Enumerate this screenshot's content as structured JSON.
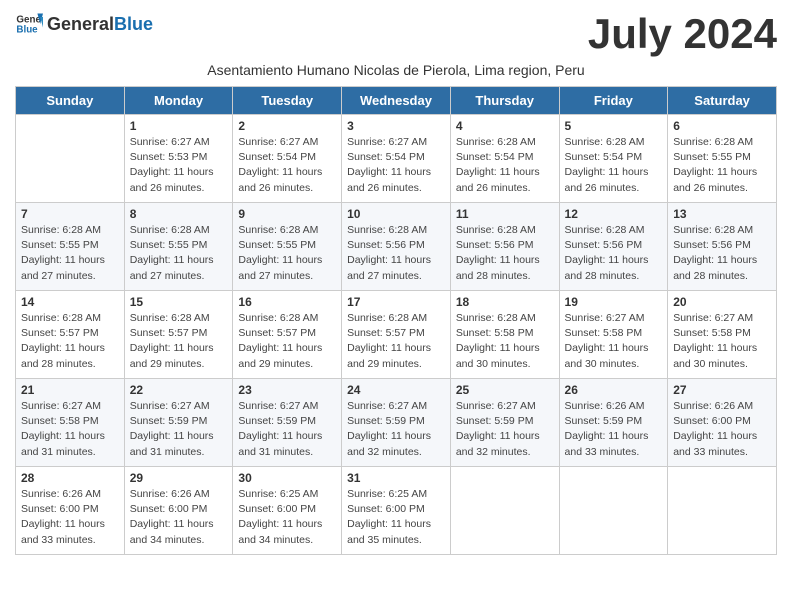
{
  "logo": {
    "general": "General",
    "blue": "Blue"
  },
  "title": "July 2024",
  "subtitle": "Asentamiento Humano Nicolas de Pierola, Lima region, Peru",
  "days_of_week": [
    "Sunday",
    "Monday",
    "Tuesday",
    "Wednesday",
    "Thursday",
    "Friday",
    "Saturday"
  ],
  "weeks": [
    [
      {
        "day": "",
        "info": ""
      },
      {
        "day": "1",
        "info": "Sunrise: 6:27 AM\nSunset: 5:53 PM\nDaylight: 11 hours\nand 26 minutes."
      },
      {
        "day": "2",
        "info": "Sunrise: 6:27 AM\nSunset: 5:54 PM\nDaylight: 11 hours\nand 26 minutes."
      },
      {
        "day": "3",
        "info": "Sunrise: 6:27 AM\nSunset: 5:54 PM\nDaylight: 11 hours\nand 26 minutes."
      },
      {
        "day": "4",
        "info": "Sunrise: 6:28 AM\nSunset: 5:54 PM\nDaylight: 11 hours\nand 26 minutes."
      },
      {
        "day": "5",
        "info": "Sunrise: 6:28 AM\nSunset: 5:54 PM\nDaylight: 11 hours\nand 26 minutes."
      },
      {
        "day": "6",
        "info": "Sunrise: 6:28 AM\nSunset: 5:55 PM\nDaylight: 11 hours\nand 26 minutes."
      }
    ],
    [
      {
        "day": "7",
        "info": "Sunrise: 6:28 AM\nSunset: 5:55 PM\nDaylight: 11 hours\nand 27 minutes."
      },
      {
        "day": "8",
        "info": "Sunrise: 6:28 AM\nSunset: 5:55 PM\nDaylight: 11 hours\nand 27 minutes."
      },
      {
        "day": "9",
        "info": "Sunrise: 6:28 AM\nSunset: 5:55 PM\nDaylight: 11 hours\nand 27 minutes."
      },
      {
        "day": "10",
        "info": "Sunrise: 6:28 AM\nSunset: 5:56 PM\nDaylight: 11 hours\nand 27 minutes."
      },
      {
        "day": "11",
        "info": "Sunrise: 6:28 AM\nSunset: 5:56 PM\nDaylight: 11 hours\nand 28 minutes."
      },
      {
        "day": "12",
        "info": "Sunrise: 6:28 AM\nSunset: 5:56 PM\nDaylight: 11 hours\nand 28 minutes."
      },
      {
        "day": "13",
        "info": "Sunrise: 6:28 AM\nSunset: 5:56 PM\nDaylight: 11 hours\nand 28 minutes."
      }
    ],
    [
      {
        "day": "14",
        "info": "Sunrise: 6:28 AM\nSunset: 5:57 PM\nDaylight: 11 hours\nand 28 minutes."
      },
      {
        "day": "15",
        "info": "Sunrise: 6:28 AM\nSunset: 5:57 PM\nDaylight: 11 hours\nand 29 minutes."
      },
      {
        "day": "16",
        "info": "Sunrise: 6:28 AM\nSunset: 5:57 PM\nDaylight: 11 hours\nand 29 minutes."
      },
      {
        "day": "17",
        "info": "Sunrise: 6:28 AM\nSunset: 5:57 PM\nDaylight: 11 hours\nand 29 minutes."
      },
      {
        "day": "18",
        "info": "Sunrise: 6:28 AM\nSunset: 5:58 PM\nDaylight: 11 hours\nand 30 minutes."
      },
      {
        "day": "19",
        "info": "Sunrise: 6:27 AM\nSunset: 5:58 PM\nDaylight: 11 hours\nand 30 minutes."
      },
      {
        "day": "20",
        "info": "Sunrise: 6:27 AM\nSunset: 5:58 PM\nDaylight: 11 hours\nand 30 minutes."
      }
    ],
    [
      {
        "day": "21",
        "info": "Sunrise: 6:27 AM\nSunset: 5:58 PM\nDaylight: 11 hours\nand 31 minutes."
      },
      {
        "day": "22",
        "info": "Sunrise: 6:27 AM\nSunset: 5:59 PM\nDaylight: 11 hours\nand 31 minutes."
      },
      {
        "day": "23",
        "info": "Sunrise: 6:27 AM\nSunset: 5:59 PM\nDaylight: 11 hours\nand 31 minutes."
      },
      {
        "day": "24",
        "info": "Sunrise: 6:27 AM\nSunset: 5:59 PM\nDaylight: 11 hours\nand 32 minutes."
      },
      {
        "day": "25",
        "info": "Sunrise: 6:27 AM\nSunset: 5:59 PM\nDaylight: 11 hours\nand 32 minutes."
      },
      {
        "day": "26",
        "info": "Sunrise: 6:26 AM\nSunset: 5:59 PM\nDaylight: 11 hours\nand 33 minutes."
      },
      {
        "day": "27",
        "info": "Sunrise: 6:26 AM\nSunset: 6:00 PM\nDaylight: 11 hours\nand 33 minutes."
      }
    ],
    [
      {
        "day": "28",
        "info": "Sunrise: 6:26 AM\nSunset: 6:00 PM\nDaylight: 11 hours\nand 33 minutes."
      },
      {
        "day": "29",
        "info": "Sunrise: 6:26 AM\nSunset: 6:00 PM\nDaylight: 11 hours\nand 34 minutes."
      },
      {
        "day": "30",
        "info": "Sunrise: 6:25 AM\nSunset: 6:00 PM\nDaylight: 11 hours\nand 34 minutes."
      },
      {
        "day": "31",
        "info": "Sunrise: 6:25 AM\nSunset: 6:00 PM\nDaylight: 11 hours\nand 35 minutes."
      },
      {
        "day": "",
        "info": ""
      },
      {
        "day": "",
        "info": ""
      },
      {
        "day": "",
        "info": ""
      }
    ]
  ]
}
